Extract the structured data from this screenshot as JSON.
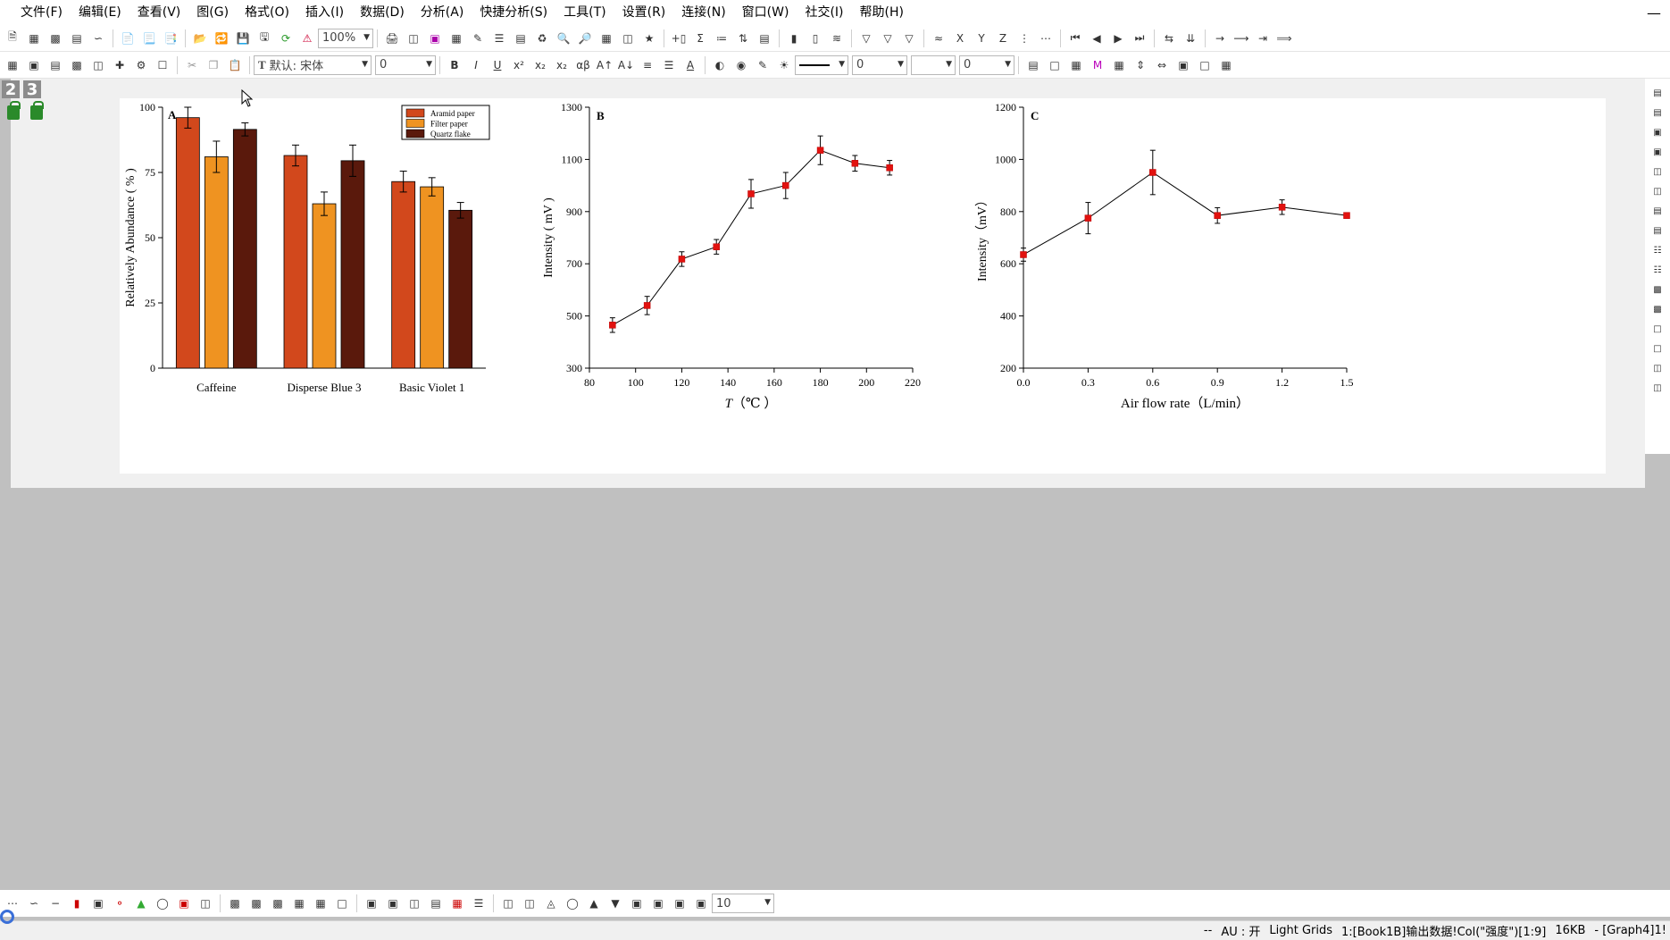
{
  "menu": [
    "文件(F)",
    "编辑(E)",
    "查看(V)",
    "图(G)",
    "格式(O)",
    "插入(I)",
    "数据(D)",
    "分析(A)",
    "快捷分析(S)",
    "工具(T)",
    "设置(R)",
    "连接(N)",
    "窗口(W)",
    "社交(I)",
    "帮助(H)"
  ],
  "toolbar": {
    "zoom": "100%",
    "font_name": "默认: 宋体",
    "font_size": "0",
    "line_width": "0",
    "fill_value": "0"
  },
  "window_badges": [
    "2",
    "3"
  ],
  "bottom_toolbar": {
    "size_value": "10"
  },
  "status": {
    "dashes": "--",
    "au": "AU : 开",
    "grids": "Light Grids",
    "ref": "1:[Book1B]输出数据!Col(\"强度\")[1:9]",
    "size": "16KB",
    "graph": "- [Graph4]1!"
  },
  "colors": {
    "aramid": "#d2481c",
    "filter": "#ef9321",
    "quartz": "#5a190c",
    "marker": "#e2120f"
  },
  "chart_data": [
    {
      "type": "bar",
      "panel_label": "A",
      "ylabel": "Relatively Abundance ( % )",
      "ylim": [
        0,
        100
      ],
      "yticks": [
        0,
        25,
        50,
        75,
        100
      ],
      "categories": [
        "Caffeine",
        "Disperse Blue 3",
        "Basic Violet 1"
      ],
      "series": [
        {
          "name": "Aramid paper",
          "values": [
            96,
            81.5,
            71.5
          ],
          "errors": [
            4,
            4,
            4
          ]
        },
        {
          "name": "Filter paper",
          "values": [
            81,
            63,
            69.5
          ],
          "errors": [
            6,
            4.5,
            3.5
          ]
        },
        {
          "name": "Quartz flake",
          "values": [
            91.5,
            79.5,
            60.5
          ],
          "errors": [
            2.5,
            6,
            3
          ]
        }
      ],
      "legend": "top-right"
    },
    {
      "type": "line",
      "panel_label": "B",
      "ylabel": "Intensity ( mV )",
      "xlabel_var": "T",
      "xlabel_unit": "（℃ ）",
      "xlim": [
        80,
        220
      ],
      "xticks": [
        80,
        100,
        120,
        140,
        160,
        180,
        200,
        220
      ],
      "ylim": [
        300,
        1300
      ],
      "yticks": [
        300,
        500,
        700,
        900,
        1100,
        1300
      ],
      "x": [
        90,
        105,
        120,
        135,
        150,
        165,
        180,
        195,
        210
      ],
      "y": [
        465,
        540,
        718,
        765,
        968,
        1000,
        1135,
        1085,
        1068
      ],
      "errors": [
        28,
        35,
        28,
        28,
        55,
        50,
        55,
        30,
        28
      ]
    },
    {
      "type": "line",
      "panel_label": "C",
      "ylabel": "Intensity（mV）",
      "xlabel": "Air flow rate（L/min）",
      "xlim": [
        0.0,
        1.5
      ],
      "xticks": [
        "0.0",
        "0.3",
        "0.6",
        "0.9",
        "1.2",
        "1.5"
      ],
      "ylim": [
        200,
        1200
      ],
      "yticks": [
        200,
        400,
        600,
        800,
        1000,
        1200
      ],
      "x": [
        0.0,
        0.3,
        0.6,
        0.9,
        1.2,
        1.5
      ],
      "y": [
        635,
        775,
        950,
        785,
        817,
        785
      ],
      "errors": [
        25,
        60,
        85,
        30,
        28,
        8
      ]
    }
  ]
}
